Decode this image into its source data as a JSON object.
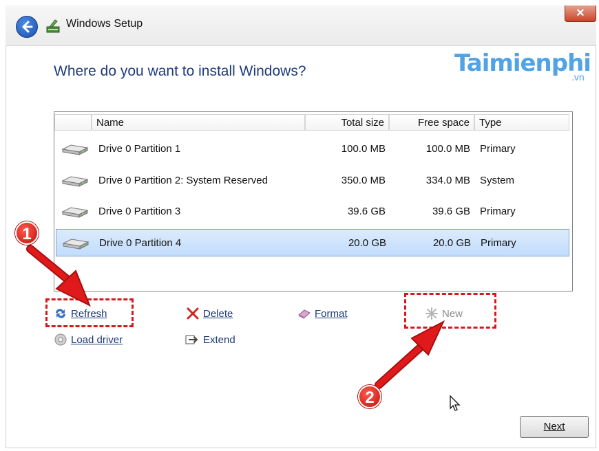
{
  "window": {
    "title": "Windows Setup",
    "close_glyph": "✕"
  },
  "logo": {
    "main": "Taimienphi",
    "sub": ".vn"
  },
  "heading": "Where do you want to install Windows?",
  "table": {
    "columns": {
      "name": "Name",
      "total": "Total size",
      "free": "Free space",
      "type": "Type"
    },
    "rows": [
      {
        "name": "Drive 0 Partition 1",
        "total": "100.0 MB",
        "free": "100.0 MB",
        "type": "Primary",
        "selected": false
      },
      {
        "name": "Drive 0 Partition 2: System Reserved",
        "total": "350.0 MB",
        "free": "334.0 MB",
        "type": "System",
        "selected": false
      },
      {
        "name": "Drive 0 Partition 3",
        "total": "39.6 GB",
        "free": "39.6 GB",
        "type": "Primary",
        "selected": false
      },
      {
        "name": "Drive 0 Partition 4",
        "total": "20.0 GB",
        "free": "20.0 GB",
        "type": "Primary",
        "selected": true
      }
    ]
  },
  "actions": {
    "refresh": "Refresh",
    "delete": "Delete",
    "format": "Format",
    "new": "New",
    "load_driver": "Load driver",
    "extend": "Extend"
  },
  "annotations": {
    "step1": "1",
    "step2": "2"
  },
  "next_button": "Next",
  "colors": {
    "heading": "#1e3a78",
    "annotation_red": "#d8161b",
    "selection": "#c1dcfc",
    "logo": "#4fa3e6"
  },
  "icons": [
    "back-arrow-icon",
    "setup-icon",
    "close-icon",
    "drive-icon",
    "refresh-icon",
    "delete-icon",
    "format-icon",
    "new-icon",
    "load-driver-icon",
    "extend-icon",
    "cursor-icon"
  ]
}
